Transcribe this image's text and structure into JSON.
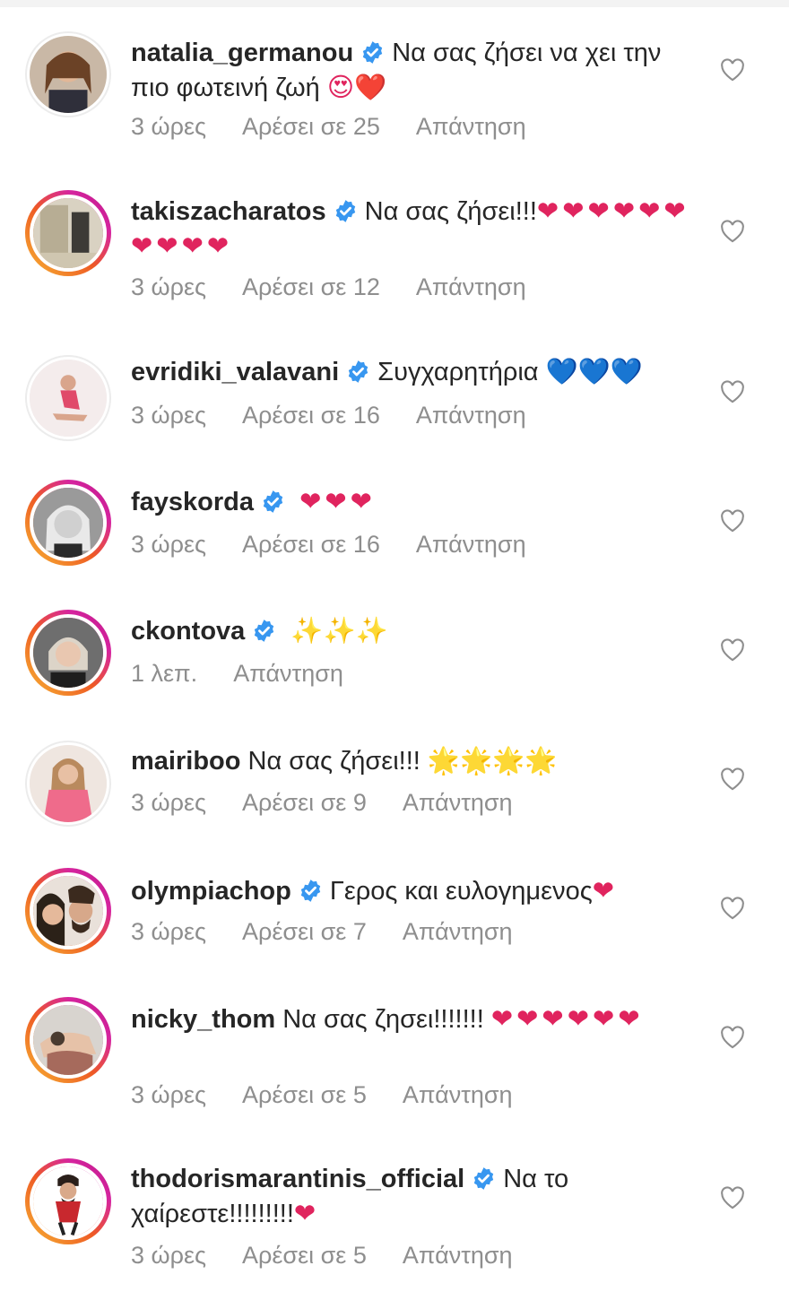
{
  "comments": [
    {
      "username": "natalia_germanou",
      "verified": true,
      "text": "Να σας ζήσει να χει την πιο φωτεινή ζωή",
      "emoji": "😍❤️",
      "time": "3 ώρες",
      "likes": "Αρέσει σε 25",
      "reply": "Απάντηση"
    },
    {
      "username": "takiszacharatos",
      "verified": true,
      "text": "Να σας ζήσει!!!",
      "emoji": "❤❤❤❤❤❤❤❤❤❤",
      "time": "3 ώρες",
      "likes": "Αρέσει σε 12",
      "reply": "Απάντηση"
    },
    {
      "username": "evridiki_valavani",
      "verified": true,
      "text": "Συγχαρητήρια",
      "emoji": "💙💙💙",
      "time": "3 ώρες",
      "likes": "Αρέσει σε 16",
      "reply": "Απάντηση"
    },
    {
      "username": "fayskorda",
      "verified": true,
      "text": "",
      "emoji": "❤❤❤",
      "time": "3 ώρες",
      "likes": "Αρέσει σε 16",
      "reply": "Απάντηση"
    },
    {
      "username": "ckontova",
      "verified": true,
      "text": "",
      "emoji": "✨✨✨",
      "time": "1 λεπ.",
      "likes": "",
      "reply": "Απάντηση"
    },
    {
      "username": "mairiboo",
      "verified": false,
      "text": "Να σας ζήσει!!!",
      "emoji": "🌟🌟🌟🌟",
      "time": "3 ώρες",
      "likes": "Αρέσει σε 9",
      "reply": "Απάντηση"
    },
    {
      "username": "olympiachop",
      "verified": true,
      "text": "Γερος και ευλογημενος",
      "emoji": "❤",
      "time": "3 ώρες",
      "likes": "Αρέσει σε 7",
      "reply": "Απάντηση"
    },
    {
      "username": "nicky_thom",
      "verified": false,
      "text": "Να σας ζησει!!!!!!!",
      "emoji": "❤❤❤❤❤❤",
      "time": "3 ώρες",
      "likes": "Αρέσει σε 5",
      "reply": "Απάντηση"
    },
    {
      "username": "thodorismarantinis_official",
      "verified": true,
      "text": "Να το χαίρεστε!!!!!!!!!",
      "emoji": "❤",
      "time": "3 ώρες",
      "likes": "Αρέσει σε 5",
      "reply": "Απάντηση"
    }
  ],
  "icons": {
    "verified": "verified-badge-icon",
    "like": "heart-outline-icon"
  },
  "colors": {
    "verified_blue": "#3897f0",
    "meta_gray": "#8e8e8e",
    "heart_red": "#e0245e"
  }
}
